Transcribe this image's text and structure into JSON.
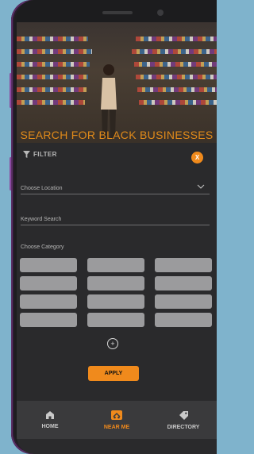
{
  "hero": {
    "title": "SEARCH FOR BLACK BUSINESSES"
  },
  "filter": {
    "label": "FILTER",
    "close_label": "X"
  },
  "fields": {
    "location_placeholder": "Choose Location",
    "keyword_placeholder": "Keyword Search"
  },
  "category": {
    "label": "Choose Category",
    "pill_count": 12
  },
  "apply": {
    "label": "APPLY"
  },
  "nav": {
    "items": [
      {
        "label": "HOME",
        "icon": "home-icon",
        "active": false
      },
      {
        "label": "NEAR ME",
        "icon": "near-me-icon",
        "active": true
      },
      {
        "label": "DIRECTORY",
        "icon": "tag-icon",
        "active": false
      }
    ]
  },
  "colors": {
    "accent": "#f08a1c",
    "background": "#2a2a2c",
    "nav_bg": "#3a3a3c"
  }
}
